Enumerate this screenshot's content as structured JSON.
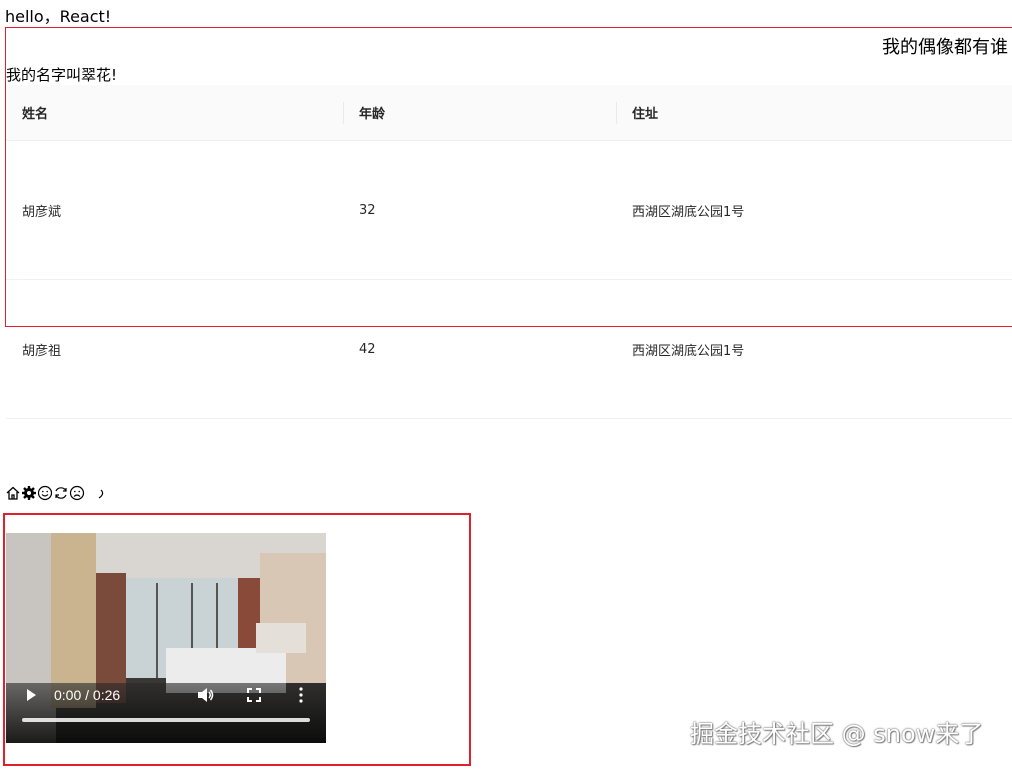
{
  "greeting": "hello，React!",
  "idol_text": "我的偶像都有谁",
  "name_text": "我的名字叫翠花!",
  "table": {
    "columns": [
      "姓名",
      "年龄",
      "住址"
    ],
    "rows": [
      [
        "胡彦斌",
        "32",
        "西湖区湖底公园1号"
      ],
      [
        "胡彦祖",
        "42",
        "西湖区湖底公园1号"
      ]
    ]
  },
  "icons": [
    "home-icon",
    "gear-icon",
    "smile-icon",
    "sync-icon",
    "frown-icon",
    "crescent-icon"
  ],
  "video": {
    "time": "0:00 / 0:26",
    "progress": 0
  },
  "watermark": "掘金技术社区 @ snow来了",
  "colors": {
    "highlight_border": "#e0202a",
    "table_header_bg": "#fafafa"
  }
}
